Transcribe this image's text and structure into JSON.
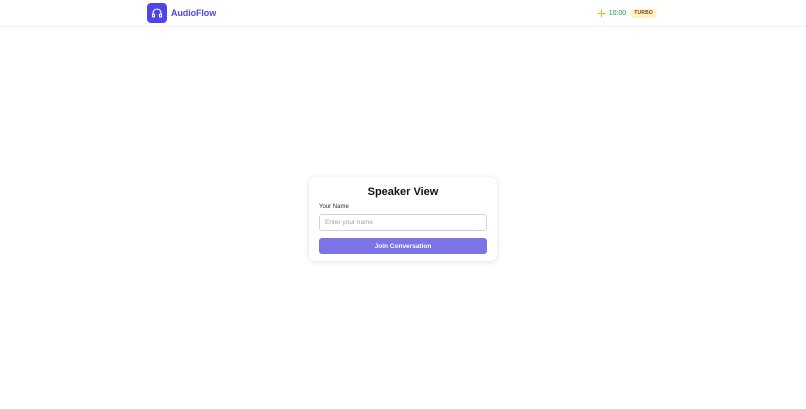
{
  "header": {
    "app_name": "AudioFlow",
    "logo_icon": "headphones-icon",
    "status_icon": "sparkle-icon",
    "timer": "10:00",
    "badge": "TURBO"
  },
  "card": {
    "title": "Speaker View",
    "name_label": "Your Name",
    "name_value": "",
    "name_placeholder": "Enter your name",
    "join_label": "Join Conversation"
  },
  "colors": {
    "brand": "#4f46e5",
    "button": "#7c73e6",
    "timer": "#16a34a",
    "sparkle": "#f59e0b",
    "badge_bg": "#fef3c7"
  }
}
